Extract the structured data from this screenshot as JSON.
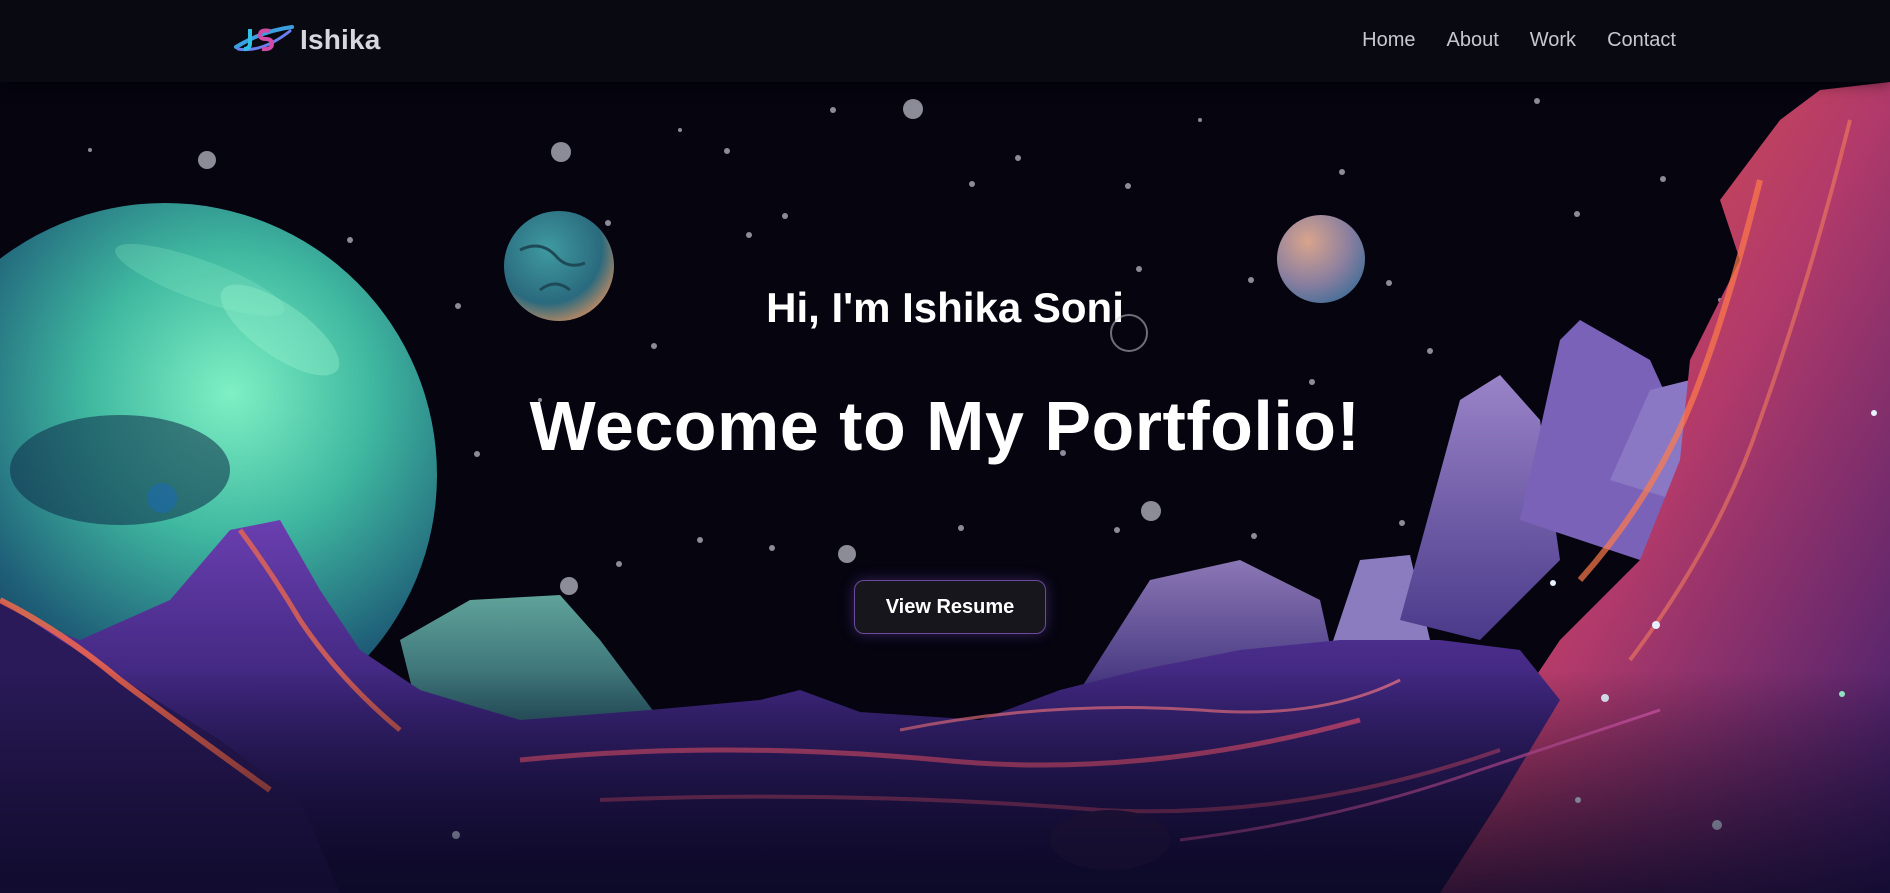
{
  "header": {
    "brand": "Ishika",
    "logo_icon": "js-orbit-logo-icon",
    "nav": [
      {
        "label": "Home"
      },
      {
        "label": "About"
      },
      {
        "label": "Work"
      },
      {
        "label": "Contact"
      }
    ]
  },
  "hero": {
    "greeting": "Hi, I'm Ishika Soni",
    "headline": "Wecome to My Portfolio!",
    "button_label": "View Resume"
  },
  "colors": {
    "background": "#05040f",
    "accent_purple": "#6b4a9c",
    "terrain_pink": "#e8537a",
    "planet_teal": "#3fc4a0"
  }
}
